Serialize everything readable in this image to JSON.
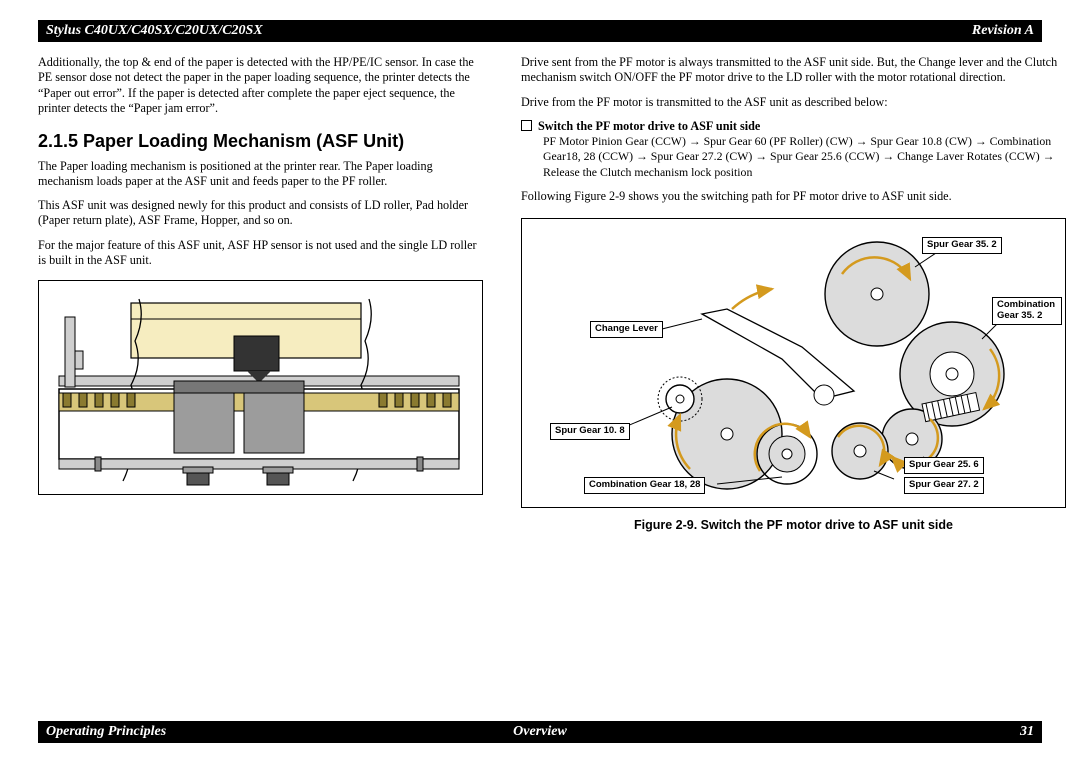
{
  "header": {
    "left": "Stylus C40UX/C40SX/C20UX/C20SX",
    "right": "Revision A"
  },
  "footer": {
    "left": "Operating Principles",
    "center": "Overview",
    "right": "31"
  },
  "left_col": {
    "p1": "Additionally, the top & end of the paper is detected with the HP/PE/IC sensor. In case the PE sensor dose not detect the paper in the paper loading sequence, the printer detects the “Paper out error”. If the paper is detected after complete the paper eject sequence, the printer detects the “Paper jam error”.",
    "heading": "2.1.5  Paper Loading Mechanism (ASF Unit)",
    "p2": "The Paper loading mechanism is positioned at the printer rear. The Paper loading mechanism loads paper at the ASF unit and feeds paper to the PF roller.",
    "p3": " This ASF unit was designed newly for this product and consists of LD roller, Pad holder (Paper return plate), ASF Frame, Hopper, and so on.",
    "p4": "For the major feature of this ASF unit, ASF HP sensor is not used and the single LD roller is built in the ASF unit."
  },
  "right_col": {
    "p1": "Drive sent from the PF motor is always transmitted to the ASF unit side. But, the Change  lever and the Clutch mechanism switch ON/OFF the PF motor drive to the LD roller with the motor rotational direction.",
    "p2": "Drive from the PF motor is transmitted to the ASF unit as described below:",
    "sub_title": "Switch the PF motor drive to ASF unit side",
    "gearpath": "PF Motor Pinion Gear (CCW) → Spur Gear 60 (PF Roller) (CW) → Spur Gear 10.8 (CW) → Combination Gear18, 28 (CCW) → Spur Gear 27.2 (CW) → Spur Gear 25.6 (CCW) → Change Laver Rotates (CCW) → Release the Clutch mechanism lock position",
    "p3": "Following Figure 2-9 shows you the switching path for PF motor drive to ASF unit side.",
    "fig_caption": "Figure 2-9.  Switch the PF motor drive to ASF unit side",
    "labels": {
      "l1": "Spur Gear 35. 2",
      "l2": "Combination Gear 35. 2",
      "l2_line1": "Combination",
      "l2_line2": "Gear 35. 2",
      "l3": "Change Lever",
      "l4": "Spur Gear 10. 8",
      "l5": "Spur Gear 25. 6",
      "l6": "Combination Gear 18, 28",
      "l7": "Spur Gear 27. 2"
    }
  }
}
